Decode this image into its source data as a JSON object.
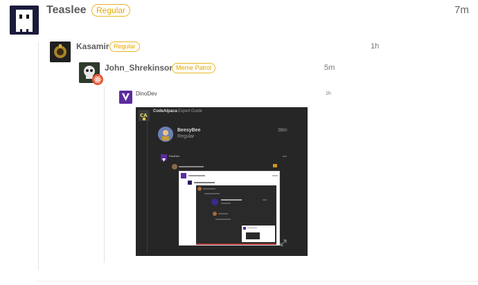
{
  "posts": {
    "main": {
      "user": "Teaslee",
      "badge": "Regular",
      "time": "7m"
    },
    "reply1": {
      "user": "Kasamir",
      "badge": "Regular",
      "time": "1h"
    },
    "reply2": {
      "user": "John_Shrekinson",
      "badge": "Meme Patrol",
      "time": "5m"
    },
    "quote": {
      "user": "DinoDev",
      "time": "1h"
    }
  },
  "screenshot": {
    "header_user": "CodeAlpaca",
    "header_role": "Expert Guide",
    "post": {
      "user": "BeesyBee",
      "role": "Regular",
      "time": "38m"
    },
    "nested_user": "DinoDev"
  },
  "colors": {
    "badge_border": "#e8b723",
    "badge_text": "#e2a700",
    "dark_bg": "#262626",
    "vertical_line": "#e3e3e3"
  },
  "icons": {
    "teaslee_avatar": "ghost-avatar-icon",
    "kasamir_avatar": "gold-emblem-avatar-icon",
    "shrek_avatar": "skull-avatar-icon",
    "shrek_sub_badge": "react-logo-icon",
    "dinodev_avatar": "dinodev-logo-icon",
    "expand": "expand-arrows-icon"
  }
}
